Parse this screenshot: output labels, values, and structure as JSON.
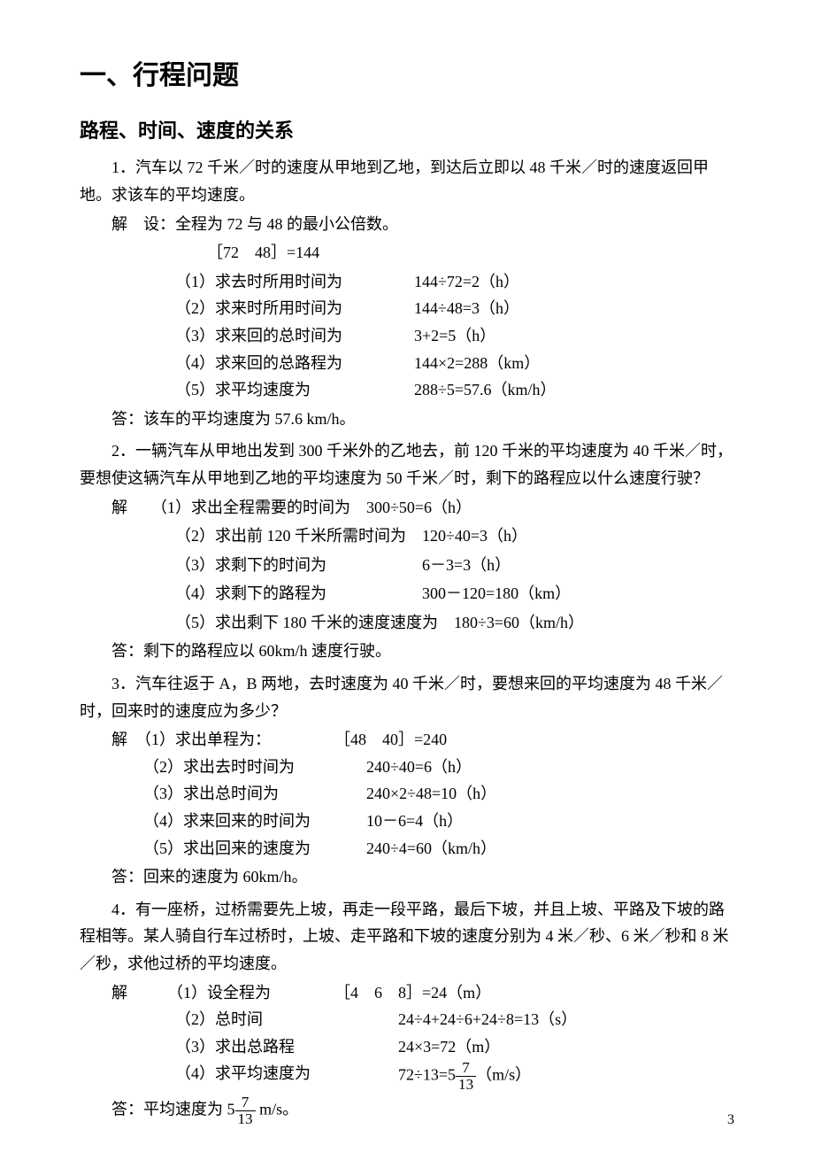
{
  "h1": "一、行程问题",
  "h2": "路程、时间、速度的关系",
  "p1": {
    "text": "1．汽车以 72 千米／时的速度从甲地到乙地，到达后立即以 48 千米／时的速度返回甲地。求该车的平均速度。",
    "sol_label": "解　设：全程为 72 与 48 的最小公倍数。",
    "l0": "［72　48］=144",
    "l1a": "（1）求去时所用时间为",
    "l1b": "144÷72=2（h）",
    "l2a": "（2）求来时所用时间为",
    "l2b": "144÷48=3（h）",
    "l3a": "（3）求来回的总时间为",
    "l3b": "3+2=5（h）",
    "l4a": "（4）求来回的总路程为",
    "l4b": "144×2=288（km）",
    "l5a": "（5）求平均速度为",
    "l5b": "288÷5=57.6（km/h）",
    "ans": "答：该车的平均速度为 57.6 km/h。"
  },
  "p2": {
    "text": "2．一辆汽车从甲地出发到 300 千米外的乙地去，前 120 千米的平均速度为 40 千米／时，要想使这辆汽车从甲地到乙地的平均速度为 50 千米／时，剩下的路程应以什么速度行驶？",
    "l1": "解　　（1）求出全程需要的时间为　300÷50=6（h）",
    "l2": "（2）求出前 120 千米所需时间为　120÷40=3（h）",
    "l3": "（3）求剩下的时间为　　　　　　6－3=3（h）",
    "l4": "（4）求剩下的路程为　　　　　　300－120=180（km）",
    "l5": "（5）求出剩下 180 千米的速度速度为　180÷3=60（km/h）",
    "ans": "答：剩下的路程应以 60km/h 速度行驶。"
  },
  "p3": {
    "text": "3．汽车往返于 A，B 两地，去时速度为 40 千米／时，要想来回的平均速度为 48 千米／时，回来时的速度应为多少？",
    "l1a": "解　（1）求出单程为：",
    "l1b": "［48　40］=240",
    "l2a": "（2）求出去时时间为",
    "l2b": "240÷40=6（h）",
    "l3a": "（3）求出总时间为",
    "l3b": "240×2÷48=10（h）",
    "l4a": "（4）求来回来的时间为",
    "l4b": "10－6=4（h）",
    "l5a": "（5）求出回来的速度为",
    "l5b": "240÷4=60（km/h）",
    "ans": "答：回来的速度为 60km/h。"
  },
  "p4": {
    "text": "4．有一座桥，过桥需要先上坡，再走一段平路，最后下坡，并且上坡、平路及下坡的路程相等。某人骑自行车过桥时，上坡、走平路和下坡的速度分别为 4 米／秒、6 米／秒和 8 米／秒，求他过桥的平均速度。",
    "l1a": "解　　　（1）设全程为",
    "l1b": "［4　6　8］=24（m）",
    "l2a": "（2）总时间",
    "l2b": "24÷4+24÷6+24÷8=13（s）",
    "l3a": "（3）求出总路程",
    "l3b": "24×3=72（m）",
    "l4a": "（4）求平均速度为",
    "l4b_pre": "72÷13=5",
    "l4b_num": "7",
    "l4b_den": "13",
    "l4b_post": "（m/s）",
    "ans_pre": "答：平均速度为 5",
    "ans_num": "7",
    "ans_den": "13",
    "ans_post": " m/s。"
  },
  "page_num": "3",
  "chart_data": {
    "type": "table",
    "title": "行程问题 例题数据与计算",
    "problems": [
      {
        "id": 1,
        "given": {
          "speed_go_km_h": 72,
          "speed_back_km_h": 48
        },
        "lcm_distance_km": 144,
        "time_go_h": 2,
        "time_back_h": 3,
        "total_time_h": 5,
        "total_distance_km": 288,
        "avg_speed_km_h": 57.6
      },
      {
        "id": 2,
        "given": {
          "total_distance_km": 300,
          "first_leg_km": 120,
          "first_leg_speed_km_h": 40,
          "target_avg_speed_km_h": 50
        },
        "total_time_h": 6,
        "first_leg_time_h": 3,
        "remaining_time_h": 3,
        "remaining_distance_km": 180,
        "required_speed_km_h": 60
      },
      {
        "id": 3,
        "given": {
          "speed_go_km_h": 40,
          "target_avg_speed_km_h": 48
        },
        "lcm_single_leg_km": 240,
        "time_go_h": 6,
        "total_time_h": 10,
        "time_back_h": 4,
        "speed_back_km_h": 60
      },
      {
        "id": 4,
        "given": {
          "speeds_m_s": [
            4,
            6,
            8
          ]
        },
        "lcm_each_leg_m": 24,
        "total_time_s": 13,
        "total_distance_m": 72,
        "avg_speed_m_s": {
          "whole": 5,
          "numerator": 7,
          "denominator": 13
        }
      }
    ]
  }
}
